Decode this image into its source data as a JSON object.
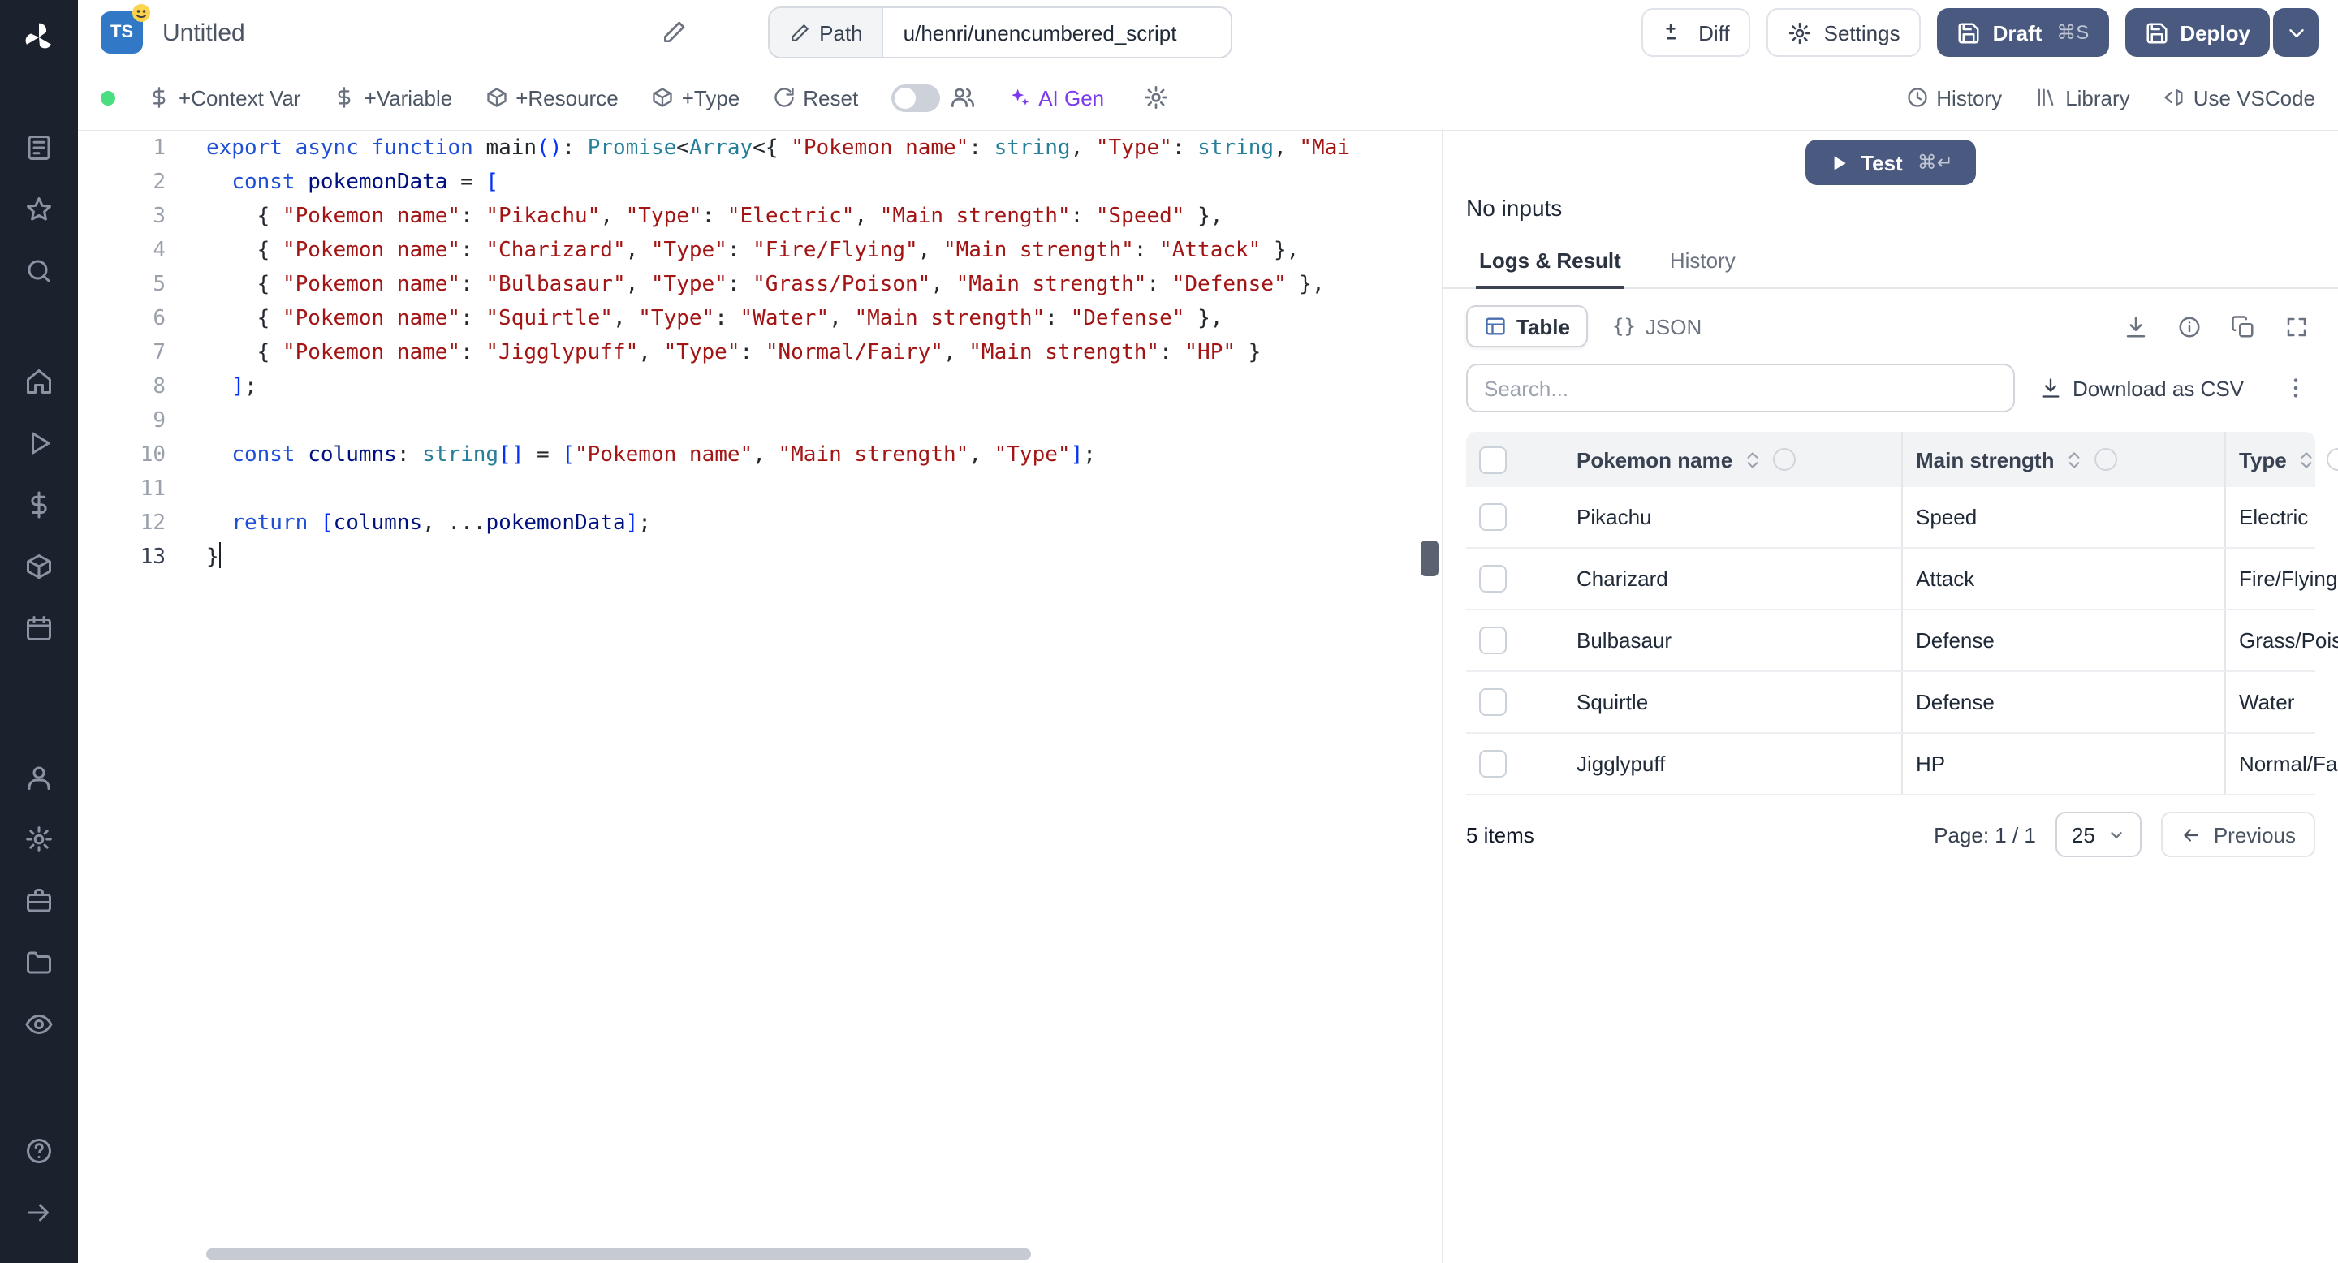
{
  "topbar": {
    "file_type": "TS",
    "title": "Untitled",
    "path_label": "Path",
    "path_value": "u/henri/unencumbered_script",
    "diff_label": "Diff",
    "settings_label": "Settings",
    "draft_label": "Draft",
    "draft_shortcut": "⌘S",
    "deploy_label": "Deploy"
  },
  "toolbar": {
    "add_context_var": "+Context Var",
    "add_variable": "+Variable",
    "add_resource": "+Resource",
    "add_type": "+Type",
    "reset": "Reset",
    "ai_gen": "AI Gen",
    "history": "History",
    "library": "Library",
    "use_vscode": "Use VSCode"
  },
  "editor": {
    "language": "typescript",
    "active_line": 13,
    "lines": [
      [
        {
          "c": "kw",
          "t": "export "
        },
        {
          "c": "kw",
          "t": "async "
        },
        {
          "c": "kw",
          "t": "function "
        },
        {
          "c": "fn",
          "t": "main"
        },
        {
          "c": "br",
          "t": "()"
        },
        {
          "c": "pl",
          "t": ": "
        },
        {
          "c": "ty",
          "t": "Promise"
        },
        {
          "c": "pl",
          "t": "<"
        },
        {
          "c": "ty",
          "t": "Array"
        },
        {
          "c": "pl",
          "t": "<{ "
        },
        {
          "c": "st",
          "t": "\"Pokemon name\""
        },
        {
          "c": "pl",
          "t": ": "
        },
        {
          "c": "ty",
          "t": "string"
        },
        {
          "c": "pl",
          "t": ", "
        },
        {
          "c": "st",
          "t": "\"Type\""
        },
        {
          "c": "pl",
          "t": ": "
        },
        {
          "c": "ty",
          "t": "string"
        },
        {
          "c": "pl",
          "t": ", "
        },
        {
          "c": "st",
          "t": "\"Mai"
        }
      ],
      [
        {
          "c": "pl",
          "t": "  "
        },
        {
          "c": "kw",
          "t": "const"
        },
        {
          "c": "pl",
          "t": " "
        },
        {
          "c": "vr",
          "t": "pokemonData"
        },
        {
          "c": "pl",
          "t": " = "
        },
        {
          "c": "br",
          "t": "["
        }
      ],
      [
        {
          "c": "pl",
          "t": "    { "
        },
        {
          "c": "st",
          "t": "\"Pokemon name\""
        },
        {
          "c": "pl",
          "t": ": "
        },
        {
          "c": "st",
          "t": "\"Pikachu\""
        },
        {
          "c": "pl",
          "t": ", "
        },
        {
          "c": "st",
          "t": "\"Type\""
        },
        {
          "c": "pl",
          "t": ": "
        },
        {
          "c": "st",
          "t": "\"Electric\""
        },
        {
          "c": "pl",
          "t": ", "
        },
        {
          "c": "st",
          "t": "\"Main strength\""
        },
        {
          "c": "pl",
          "t": ": "
        },
        {
          "c": "st",
          "t": "\"Speed\""
        },
        {
          "c": "pl",
          "t": " },"
        }
      ],
      [
        {
          "c": "pl",
          "t": "    { "
        },
        {
          "c": "st",
          "t": "\"Pokemon name\""
        },
        {
          "c": "pl",
          "t": ": "
        },
        {
          "c": "st",
          "t": "\"Charizard\""
        },
        {
          "c": "pl",
          "t": ", "
        },
        {
          "c": "st",
          "t": "\"Type\""
        },
        {
          "c": "pl",
          "t": ": "
        },
        {
          "c": "st",
          "t": "\"Fire/Flying\""
        },
        {
          "c": "pl",
          "t": ", "
        },
        {
          "c": "st",
          "t": "\"Main strength\""
        },
        {
          "c": "pl",
          "t": ": "
        },
        {
          "c": "st",
          "t": "\"Attack\""
        },
        {
          "c": "pl",
          "t": " },"
        }
      ],
      [
        {
          "c": "pl",
          "t": "    { "
        },
        {
          "c": "st",
          "t": "\"Pokemon name\""
        },
        {
          "c": "pl",
          "t": ": "
        },
        {
          "c": "st",
          "t": "\"Bulbasaur\""
        },
        {
          "c": "pl",
          "t": ", "
        },
        {
          "c": "st",
          "t": "\"Type\""
        },
        {
          "c": "pl",
          "t": ": "
        },
        {
          "c": "st",
          "t": "\"Grass/Poison\""
        },
        {
          "c": "pl",
          "t": ", "
        },
        {
          "c": "st",
          "t": "\"Main strength\""
        },
        {
          "c": "pl",
          "t": ": "
        },
        {
          "c": "st",
          "t": "\"Defense\""
        },
        {
          "c": "pl",
          "t": " },"
        }
      ],
      [
        {
          "c": "pl",
          "t": "    { "
        },
        {
          "c": "st",
          "t": "\"Pokemon name\""
        },
        {
          "c": "pl",
          "t": ": "
        },
        {
          "c": "st",
          "t": "\"Squirtle\""
        },
        {
          "c": "pl",
          "t": ", "
        },
        {
          "c": "st",
          "t": "\"Type\""
        },
        {
          "c": "pl",
          "t": ": "
        },
        {
          "c": "st",
          "t": "\"Water\""
        },
        {
          "c": "pl",
          "t": ", "
        },
        {
          "c": "st",
          "t": "\"Main strength\""
        },
        {
          "c": "pl",
          "t": ": "
        },
        {
          "c": "st",
          "t": "\"Defense\""
        },
        {
          "c": "pl",
          "t": " },"
        }
      ],
      [
        {
          "c": "pl",
          "t": "    { "
        },
        {
          "c": "st",
          "t": "\"Pokemon name\""
        },
        {
          "c": "pl",
          "t": ": "
        },
        {
          "c": "st",
          "t": "\"Jigglypuff\""
        },
        {
          "c": "pl",
          "t": ", "
        },
        {
          "c": "st",
          "t": "\"Type\""
        },
        {
          "c": "pl",
          "t": ": "
        },
        {
          "c": "st",
          "t": "\"Normal/Fairy\""
        },
        {
          "c": "pl",
          "t": ", "
        },
        {
          "c": "st",
          "t": "\"Main strength\""
        },
        {
          "c": "pl",
          "t": ": "
        },
        {
          "c": "st",
          "t": "\"HP\""
        },
        {
          "c": "pl",
          "t": " }"
        }
      ],
      [
        {
          "c": "pl",
          "t": "  "
        },
        {
          "c": "br",
          "t": "]"
        },
        {
          "c": "pl",
          "t": ";"
        }
      ],
      [],
      [
        {
          "c": "pl",
          "t": "  "
        },
        {
          "c": "kw",
          "t": "const"
        },
        {
          "c": "pl",
          "t": " "
        },
        {
          "c": "vr",
          "t": "columns"
        },
        {
          "c": "pl",
          "t": ": "
        },
        {
          "c": "ty",
          "t": "string"
        },
        {
          "c": "br",
          "t": "[]"
        },
        {
          "c": "pl",
          "t": " = "
        },
        {
          "c": "br",
          "t": "["
        },
        {
          "c": "st",
          "t": "\"Pokemon name\""
        },
        {
          "c": "pl",
          "t": ", "
        },
        {
          "c": "st",
          "t": "\"Main strength\""
        },
        {
          "c": "pl",
          "t": ", "
        },
        {
          "c": "st",
          "t": "\"Type\""
        },
        {
          "c": "br",
          "t": "]"
        },
        {
          "c": "pl",
          "t": ";"
        }
      ],
      [],
      [
        {
          "c": "pl",
          "t": "  "
        },
        {
          "c": "kw",
          "t": "return"
        },
        {
          "c": "pl",
          "t": " "
        },
        {
          "c": "br",
          "t": "["
        },
        {
          "c": "vr",
          "t": "columns"
        },
        {
          "c": "pl",
          "t": ", ..."
        },
        {
          "c": "vr",
          "t": "pokemonData"
        },
        {
          "c": "br",
          "t": "]"
        },
        {
          "c": "pl",
          "t": ";"
        }
      ],
      [
        {
          "c": "pl",
          "t": "}"
        }
      ]
    ]
  },
  "panel": {
    "test_label": "Test",
    "test_shortcut": "⌘↵",
    "no_inputs": "No inputs",
    "tabs": {
      "logs": "Logs & Result",
      "history": "History"
    },
    "active_tab": "Logs & Result",
    "view_toggle": {
      "table": "Table",
      "json_braces": "{}",
      "json": "JSON"
    },
    "search_placeholder": "Search...",
    "download_csv": "Download as CSV",
    "footer": {
      "items": "5 items",
      "page": "Page: 1 / 1",
      "page_size": "25",
      "previous": "Previous"
    }
  },
  "result_table": {
    "columns": [
      "Pokemon name",
      "Main strength",
      "Type"
    ],
    "rows": [
      [
        "Pikachu",
        "Speed",
        "Electric"
      ],
      [
        "Charizard",
        "Attack",
        "Fire/Flying"
      ],
      [
        "Bulbasaur",
        "Defense",
        "Grass/Poison"
      ],
      [
        "Squirtle",
        "Defense",
        "Water"
      ],
      [
        "Jigglypuff",
        "HP",
        "Normal/Fairy"
      ]
    ]
  },
  "colors": {
    "sidebar_bg": "#1c212e",
    "primary_button": "#49597f",
    "ai_accent": "#7c3aed",
    "ts_badge": "#3178c6",
    "status_dot": "#4ade80",
    "string_token": "#a31515",
    "keyword_token": "#1e4fd6",
    "type_token": "#267f99"
  }
}
